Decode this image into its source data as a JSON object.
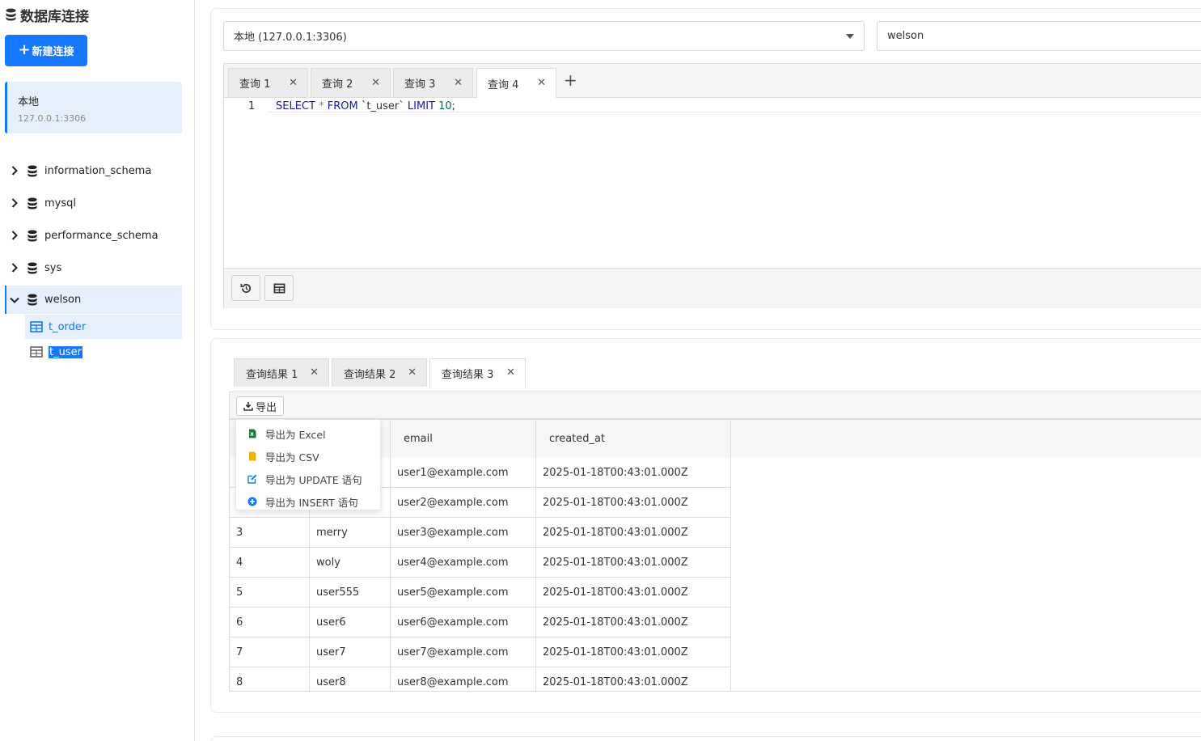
{
  "sidebar": {
    "title": "数据库连接",
    "new_connection_label": "新建连接",
    "connection": {
      "name": "本地",
      "host": "127.0.0.1:3306"
    },
    "databases": [
      {
        "name": "information_schema",
        "expanded": false
      },
      {
        "name": "mysql",
        "expanded": false
      },
      {
        "name": "performance_schema",
        "expanded": false
      },
      {
        "name": "sys",
        "expanded": false
      },
      {
        "name": "welson",
        "expanded": true
      }
    ],
    "tables": [
      {
        "name": "t_order"
      },
      {
        "name": "t_user"
      }
    ]
  },
  "connection_select": {
    "value": "本地 (127.0.0.1:3306)"
  },
  "database_select": {
    "value": "welson"
  },
  "query_tabs": [
    {
      "label": "查询 1"
    },
    {
      "label": "查询 2"
    },
    {
      "label": "查询 3"
    },
    {
      "label": "查询 4",
      "active": true
    }
  ],
  "editor": {
    "line_number": "1",
    "tokens": {
      "select": "SELECT",
      "star": " * ",
      "from": "FROM",
      "table": " `t_user` ",
      "limit": "LIMIT",
      "count": " 10",
      "semi": ";"
    }
  },
  "result_tabs": [
    {
      "label": "查询结果 1"
    },
    {
      "label": "查询结果 2"
    },
    {
      "label": "查询结果 3",
      "active": true
    }
  ],
  "export": {
    "button_label": "导出",
    "menu": [
      {
        "label": "导出为 Excel",
        "icon": "excel-file-icon",
        "color": "#1d7a3d"
      },
      {
        "label": "导出为 CSV",
        "icon": "csv-file-icon",
        "color": "#f0b400"
      },
      {
        "label": "导出为 UPDATE 语句",
        "icon": "edit-icon",
        "color": "#1677ff"
      },
      {
        "label": "导出为 INSERT 语句",
        "icon": "plus-circle-icon",
        "color": "#1677ff"
      }
    ]
  },
  "results": {
    "columns": [
      "email",
      "created_at"
    ],
    "rows": [
      [
        "",
        "",
        "user1@example.com",
        "2025-01-18T00:43:01.000Z"
      ],
      [
        "",
        "",
        "user2@example.com",
        "2025-01-18T00:43:01.000Z"
      ],
      [
        "3",
        "merry",
        "user3@example.com",
        "2025-01-18T00:43:01.000Z"
      ],
      [
        "4",
        "woly",
        "user4@example.com",
        "2025-01-18T00:43:01.000Z"
      ],
      [
        "5",
        "user555",
        "user5@example.com",
        "2025-01-18T00:43:01.000Z"
      ],
      [
        "6",
        "user6",
        "user6@example.com",
        "2025-01-18T00:43:01.000Z"
      ],
      [
        "7",
        "user7",
        "user7@example.com",
        "2025-01-18T00:43:01.000Z"
      ],
      [
        "8",
        "user8",
        "user8@example.com",
        "2025-01-18T00:43:01.000Z"
      ]
    ]
  },
  "colors": {
    "accent": "#1677ff",
    "selected_bg": "#e6f0fd"
  }
}
